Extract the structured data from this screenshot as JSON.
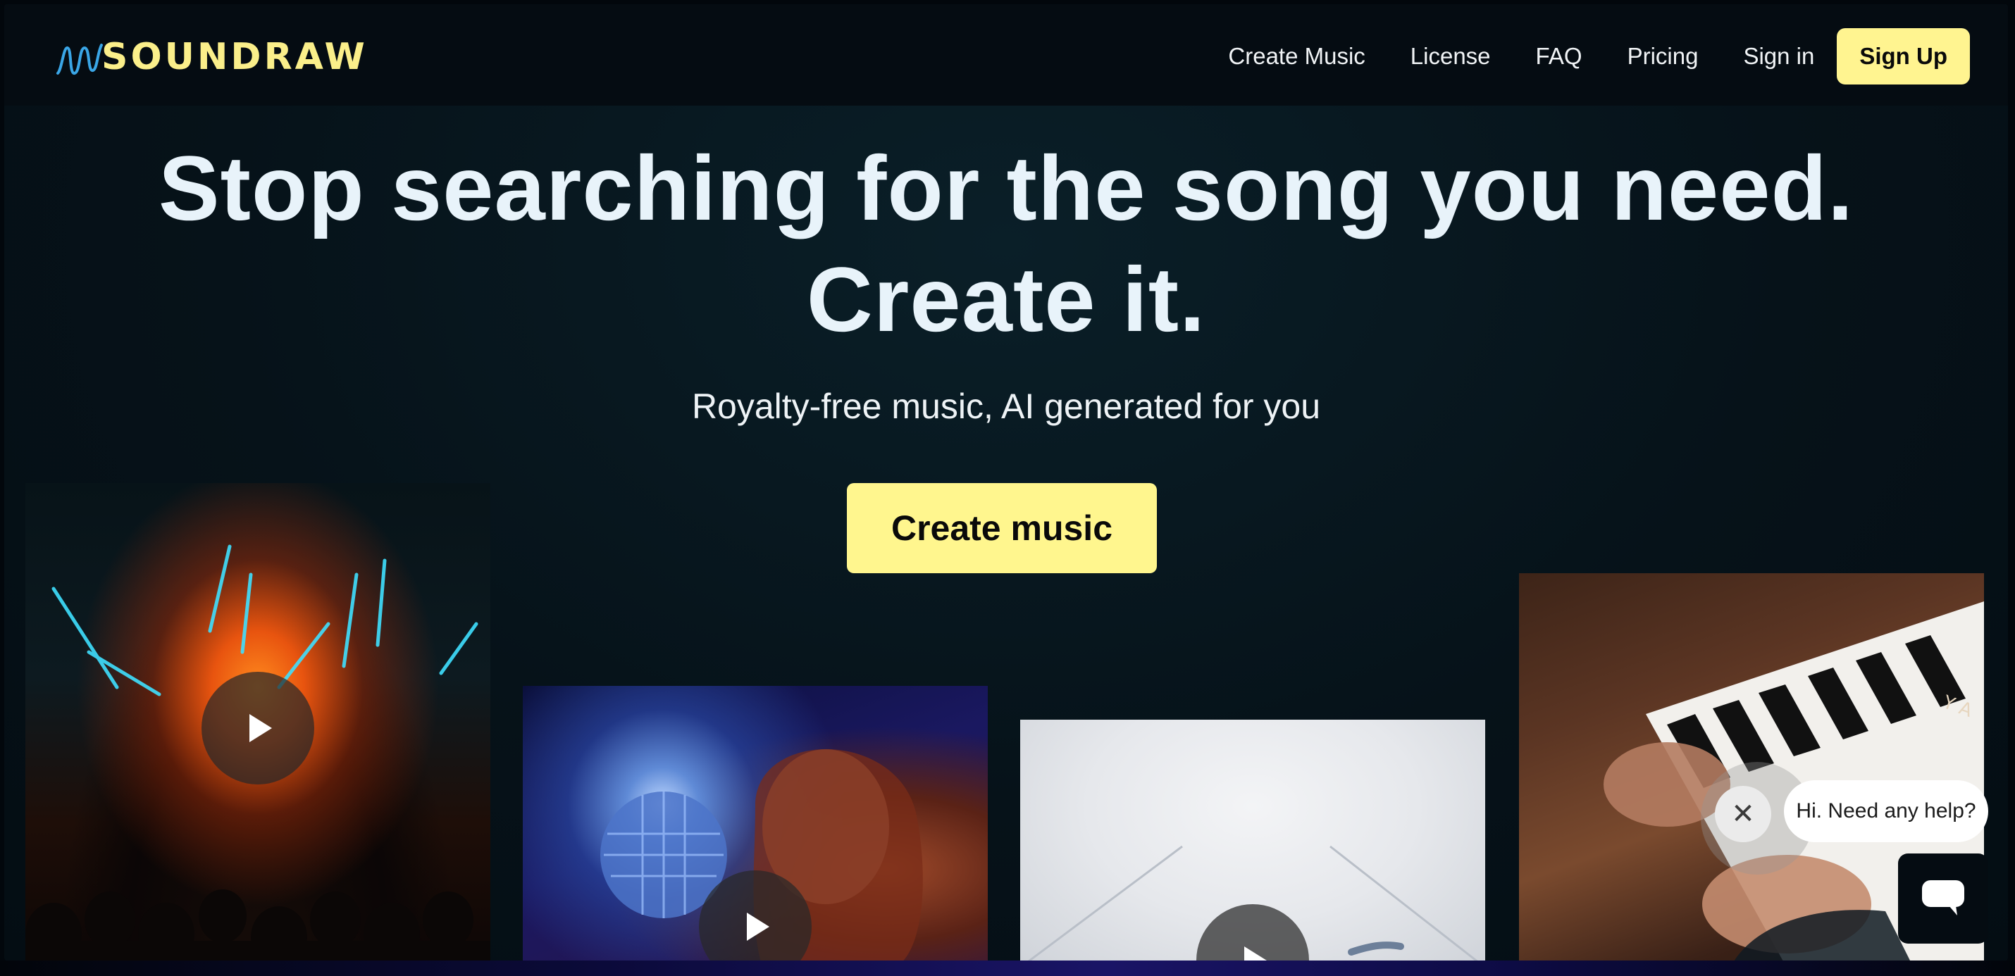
{
  "nav": {
    "logo_text": "SOUNDRAW",
    "links": [
      "Create Music",
      "License",
      "FAQ",
      "Pricing",
      "Sign in"
    ],
    "signup_label": "Sign Up"
  },
  "hero": {
    "title_line1": "Stop searching for the song you need.",
    "title_line2": "Create it.",
    "subtitle": "Royalty-free music, AI generated for you",
    "cta_label": "Create music"
  },
  "cards": [
    {
      "scene": "concert"
    },
    {
      "scene": "disco-ball"
    },
    {
      "scene": "bright-hallway"
    },
    {
      "scene": "piano"
    }
  ],
  "chat": {
    "message": "Hi. Need any help?",
    "close_icon": "close-icon",
    "launcher_icon": "chat-icon"
  },
  "colors": {
    "accent": "#fff68e",
    "logo": "#fbef8a",
    "logo_wave": "#3aa6e6",
    "background": "#061219"
  }
}
